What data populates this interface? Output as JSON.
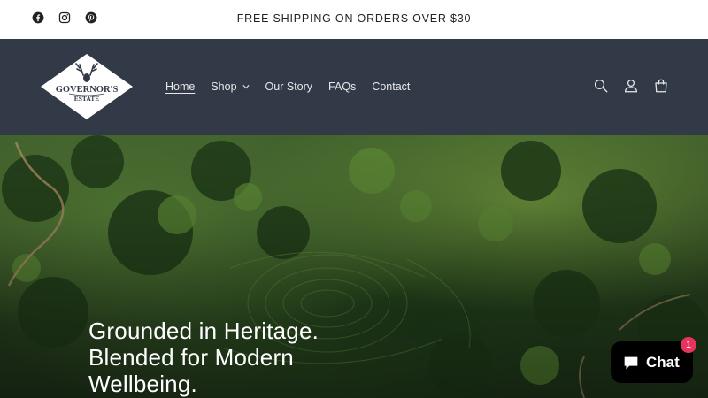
{
  "announcement": {
    "text": "FREE SHIPPING ON ORDERS OVER $30"
  },
  "social": [
    {
      "icon": "facebook-icon"
    },
    {
      "icon": "instagram-icon"
    },
    {
      "icon": "pinterest-icon"
    }
  ],
  "header": {
    "logo_top": "GOVERNOR'S",
    "logo_bottom": "ESTATE",
    "nav": [
      {
        "label": "Home",
        "active": true
      },
      {
        "label": "Shop",
        "dropdown": true
      },
      {
        "label": "Our Story"
      },
      {
        "label": "FAQs"
      },
      {
        "label": "Contact"
      }
    ],
    "icons": [
      "search-icon",
      "account-icon",
      "cart-icon"
    ]
  },
  "hero": {
    "line1": "Grounded in Heritage.",
    "line2": "Blended for Modern",
    "line3": "Wellbeing."
  },
  "chat": {
    "label": "Chat",
    "badge": "1"
  },
  "colors": {
    "header_bg": "#333a47",
    "chat_badge": "#e7335d"
  }
}
